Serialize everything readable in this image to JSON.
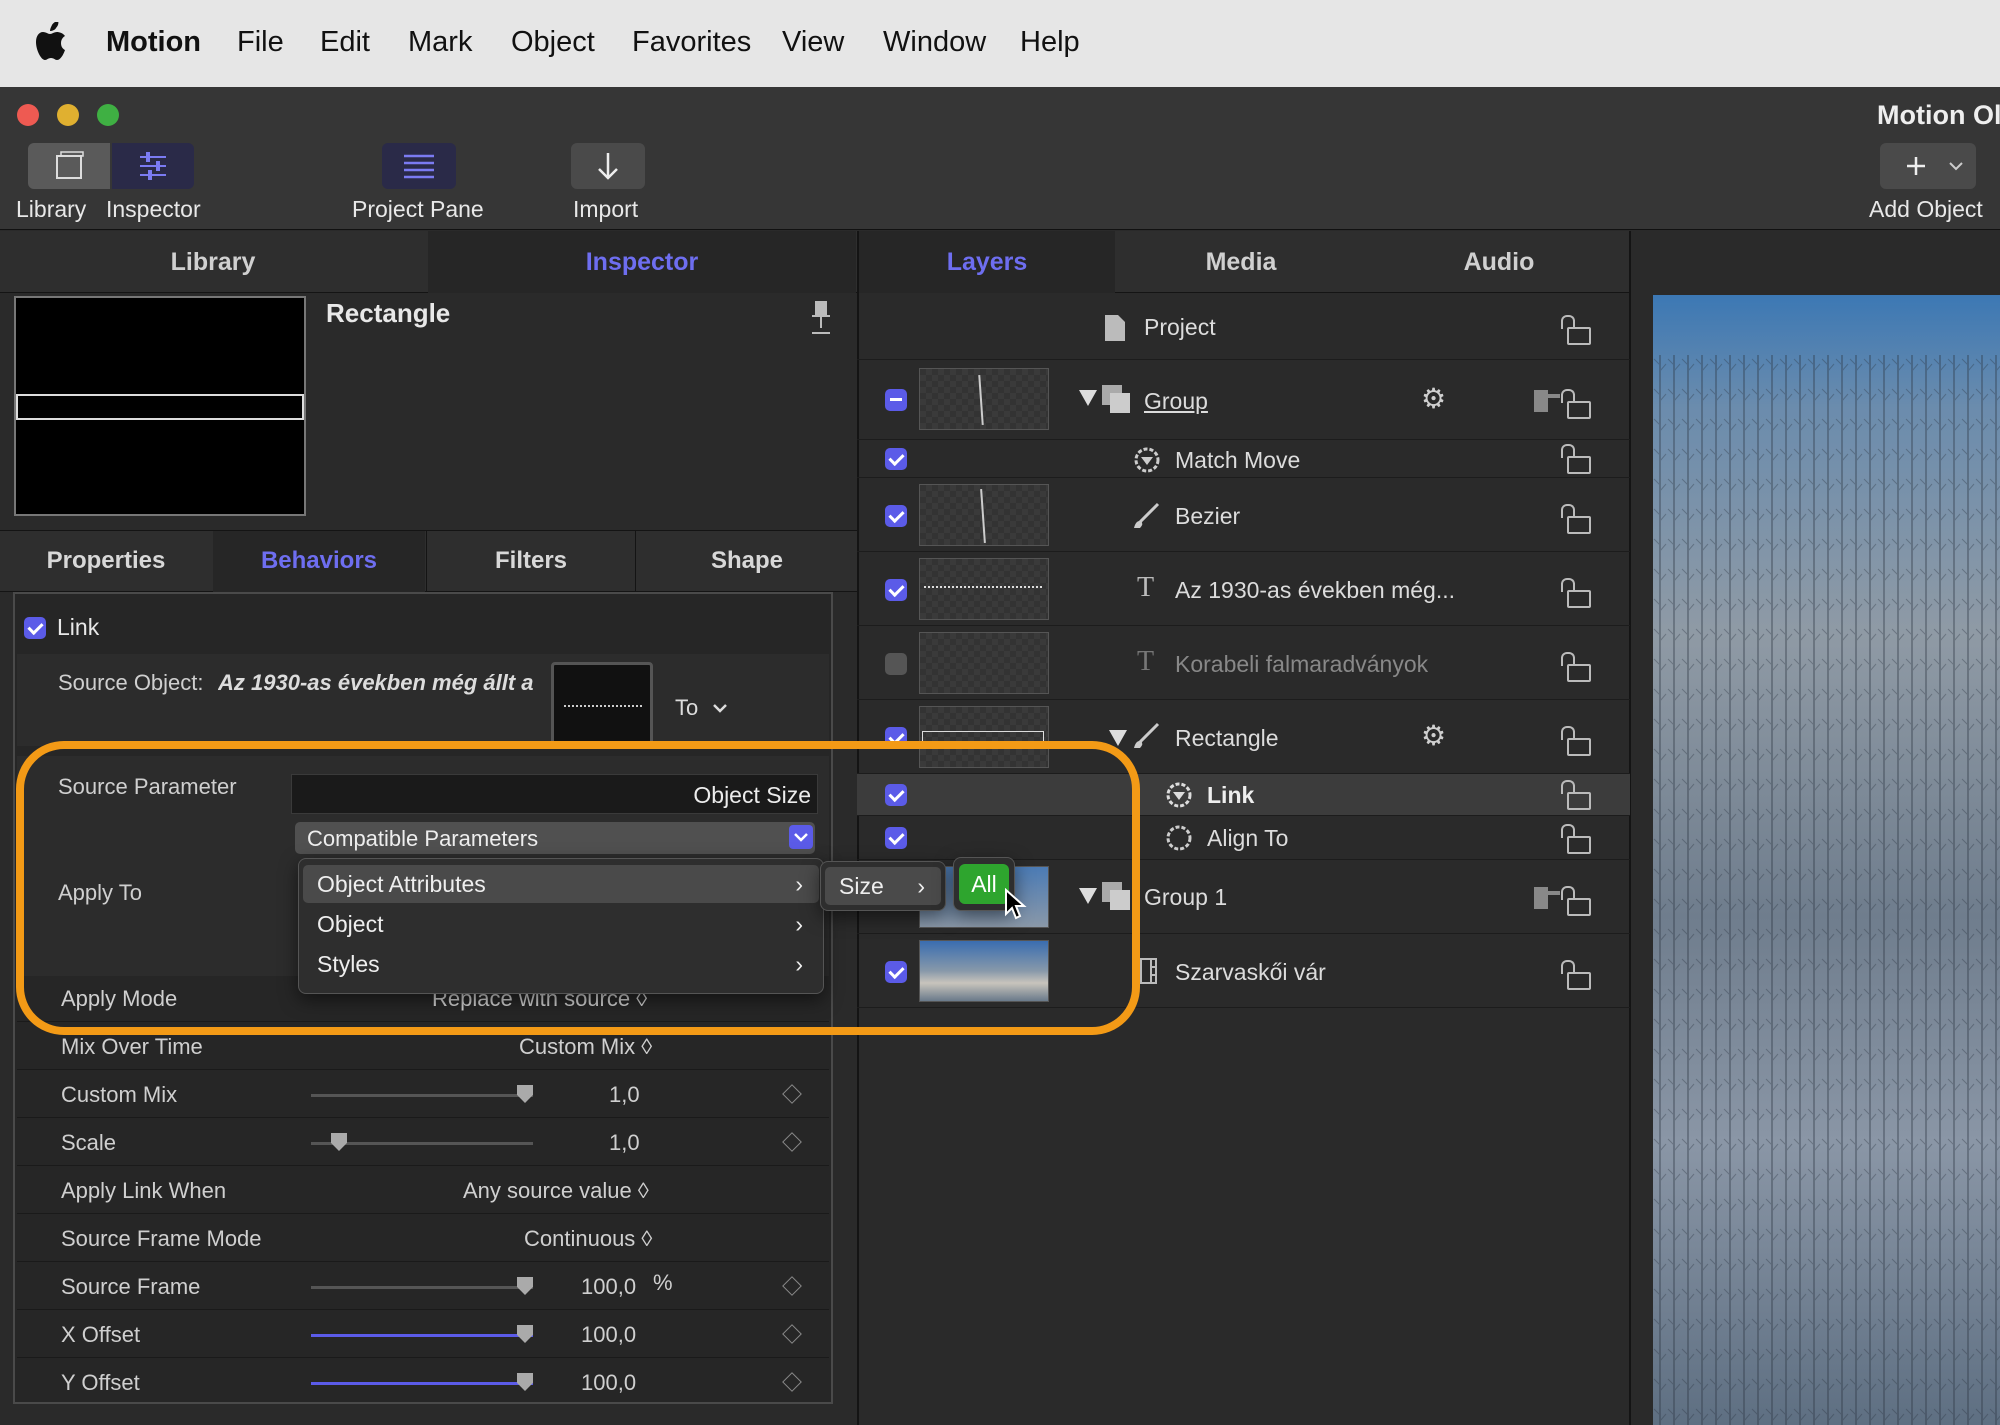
{
  "menubar": {
    "app": "Motion",
    "items": [
      "File",
      "Edit",
      "Mark",
      "Object",
      "Favorites",
      "View",
      "Window",
      "Help"
    ]
  },
  "window": {
    "title": "Motion Ol"
  },
  "toolbar": {
    "library_label": "Library",
    "inspector_label": "Inspector",
    "project_pane_label": "Project Pane",
    "import_label": "Import",
    "add_object_label": "Add Object"
  },
  "left_tabs": {
    "library": "Library",
    "inspector": "Inspector"
  },
  "right_tabs": {
    "layers": "Layers",
    "media": "Media",
    "audio": "Audio"
  },
  "inspector": {
    "object_name": "Rectangle",
    "subtabs": [
      "Properties",
      "Behaviors",
      "Filters",
      "Shape"
    ],
    "behavior_name": "Link",
    "source_object_label": "Source Object:",
    "source_object_value": "Az 1930-as években még állt a",
    "to_label": "To",
    "source_parameter_label": "Source Parameter",
    "source_parameter_value": "Object Size",
    "compatible_parameters": "Compatible Parameters",
    "apply_to_label": "Apply To",
    "params": [
      {
        "label": "Apply Mode",
        "value": "Replace with source ◊"
      },
      {
        "label": "Mix Over Time",
        "value": "Custom Mix ◊"
      },
      {
        "label": "Custom Mix",
        "value": "1,0"
      },
      {
        "label": "Scale",
        "value": "1,0"
      },
      {
        "label": "Apply Link When",
        "value": "Any source value ◊"
      },
      {
        "label": "Source Frame Mode",
        "value": "Continuous ◊"
      },
      {
        "label": "Source Frame",
        "value": "100,0",
        "unit": "%"
      },
      {
        "label": "X Offset",
        "value": "100,0"
      },
      {
        "label": "Y Offset",
        "value": "100,0"
      }
    ]
  },
  "dropdown": {
    "items": [
      "Object Attributes",
      "Object",
      "Styles"
    ],
    "submenu": "Size",
    "subsubmenu": "All"
  },
  "layers": [
    {
      "name": "Project"
    },
    {
      "name": "Group"
    },
    {
      "name": "Match Move"
    },
    {
      "name": "Bezier"
    },
    {
      "name": "Az 1930-as években még..."
    },
    {
      "name": "Korabeli falmaradványok"
    },
    {
      "name": "Rectangle"
    },
    {
      "name": "Link"
    },
    {
      "name": "Align To"
    },
    {
      "name": "Group 1"
    },
    {
      "name": "Szarvaskői vár"
    }
  ],
  "colors": {
    "accent": "#6e6ef0",
    "highlight": "#f39a16",
    "all_button": "#2ea52e"
  }
}
